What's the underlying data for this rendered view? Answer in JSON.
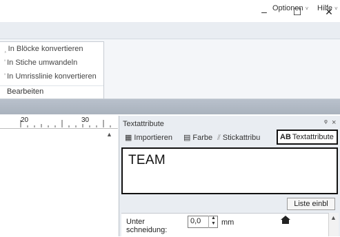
{
  "window": {
    "minimize": "–",
    "maximize": "☐",
    "close": "✕"
  },
  "menubar": {
    "optionen": "Optionen",
    "hilfe": "Hilfe",
    "caret": "˅"
  },
  "ribbon": {
    "items": [
      "In Blöcke konvertieren",
      "In Stiche umwandeln",
      "In Umrisslinie konvertieren"
    ],
    "group_label": "Bearbeiten"
  },
  "ruler": {
    "label_20": "20",
    "label_30": "30"
  },
  "panel": {
    "title": "Textattribute",
    "pin": "ᵠ",
    "close": "×",
    "tabs": [
      {
        "label": "Importieren",
        "icon": "import-icon"
      },
      {
        "label": "Farbe",
        "icon": "color-icon"
      },
      {
        "label": "Stickattribu",
        "icon": "stitch-icon"
      },
      {
        "label": "Textattribute",
        "icon": "AB"
      }
    ],
    "text_value": "TEAM",
    "list_button": "Liste einbl",
    "prop_label_line1": "Unter",
    "prop_label_line2": "schneidung:",
    "spin_value": "0,0",
    "unit": "mm"
  }
}
